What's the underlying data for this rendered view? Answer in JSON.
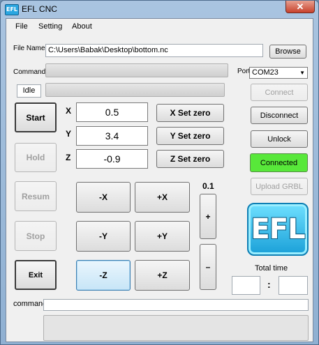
{
  "window": {
    "title": "EFL CNC",
    "icon_text": "EFL",
    "close_glyph": "✕"
  },
  "menu": {
    "items": [
      "File",
      "Setting",
      "About"
    ]
  },
  "file": {
    "label": "File Name",
    "path": "C:\\Users\\Babak\\Desktop\\bottom.nc",
    "browse_label": "Browse"
  },
  "command": {
    "label": "Command",
    "status": "Idle"
  },
  "port": {
    "label": "Port",
    "value": "COM23",
    "arrow": "▼"
  },
  "side_buttons": {
    "connect": "Connect",
    "disconnect": "Disconnect",
    "unlock": "Unlock",
    "connected": "Connected",
    "upload": "Upload GRBL"
  },
  "control": {
    "start": "Start",
    "hold": "Hold",
    "resume": "Resum",
    "stop": "Stop",
    "exit": "Exit"
  },
  "axes": {
    "x": {
      "label": "X",
      "value": "0.5",
      "zero_label": "X Set zero"
    },
    "y": {
      "label": "Y",
      "value": "3.4",
      "zero_label": "Y Set zero"
    },
    "z": {
      "label": "Z",
      "value": "-0.9",
      "zero_label": "Z Set zero"
    }
  },
  "jog": {
    "minus_x": "-X",
    "plus_x": "+X",
    "minus_y": "-Y",
    "plus_y": "+Y",
    "minus_z": "-Z",
    "plus_z": "+Z"
  },
  "step": {
    "value": "0.1",
    "plus": "+",
    "minus": "–"
  },
  "logo": {
    "text": "EFL"
  },
  "time": {
    "label": "Total time",
    "separator": ":",
    "minutes": "",
    "seconds": ""
  },
  "bottom": {
    "command_label": "command",
    "command_value": ""
  }
}
